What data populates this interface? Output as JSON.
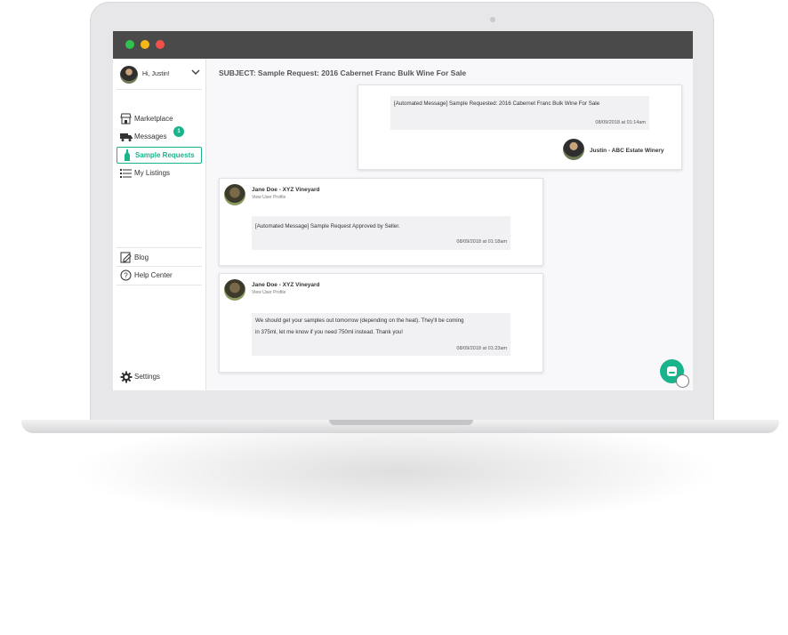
{
  "sidebar": {
    "greeting": "Hi, Justin!",
    "items": [
      {
        "label": "Marketplace",
        "icon": "store-icon"
      },
      {
        "label": "Messages",
        "icon": "truck-icon",
        "badge": "1"
      },
      {
        "label": "Sample Requests",
        "icon": "wine-bottle-icon",
        "active": true
      },
      {
        "label": "My Listings",
        "icon": "list-icon"
      }
    ],
    "bottom_items": [
      {
        "label": "Blog",
        "icon": "edit-icon"
      },
      {
        "label": "Help Center",
        "icon": "help-icon"
      }
    ],
    "settings_label": "Settings"
  },
  "thread": {
    "subject": "SUBJECT: Sample Request: 2016 Cabernet Franc Bulk Wine For Sale",
    "messages": [
      {
        "text": "[Automated Message] Sample Requested: 2016 Cabernet Franc Bulk Wine For Sale",
        "time": "08/09/2018 at 01:14am",
        "sender": "Justin - ABC Estate Winery"
      },
      {
        "sender": "Jane Doe - XYZ Vineyard",
        "profile_link": "View User Profile",
        "text": "[Automated Message] Sample Request Approved by Seller.",
        "time": "08/09/2018 at 01:18am"
      },
      {
        "sender": "Jane Doe - XYZ Vineyard",
        "profile_link": "View User Profile",
        "text_line1": "We should get your samples out tomorrow (depending on the heat). They'll be coming",
        "text_line2": "in 375ml, let me know if you need 750ml instead. Thank you!",
        "time": "08/09/2018 at 01:23am"
      }
    ]
  },
  "colors": {
    "accent": "#19b38c",
    "titlebar": "#4a4a4a",
    "close": "#f0524a",
    "minimize": "#f5b917",
    "maximize": "#2fc44f"
  }
}
